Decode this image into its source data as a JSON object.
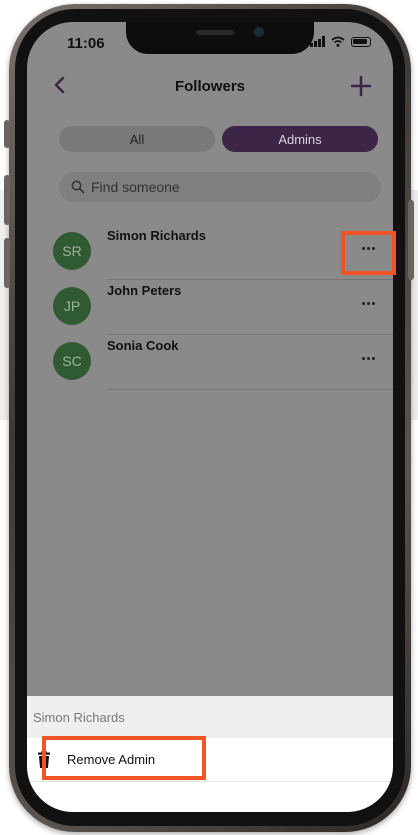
{
  "status_bar": {
    "time": "11:06"
  },
  "header": {
    "title": "Followers"
  },
  "segments": {
    "all": "All",
    "admins": "Admins",
    "active": "admins"
  },
  "search": {
    "placeholder": "Find someone"
  },
  "followers": [
    {
      "initials": "SR",
      "name": "Simon Richards"
    },
    {
      "initials": "JP",
      "name": "John Peters"
    },
    {
      "initials": "SC",
      "name": "Sonia Cook"
    }
  ],
  "action_sheet": {
    "title": "Simon Richards",
    "items": [
      {
        "label": "Remove Admin",
        "icon": "trash-icon"
      }
    ]
  },
  "colors": {
    "accent": "#3d2548",
    "avatar": "#2f5a32",
    "highlight": "#ee5522",
    "overlay": "#8a8a8a"
  }
}
